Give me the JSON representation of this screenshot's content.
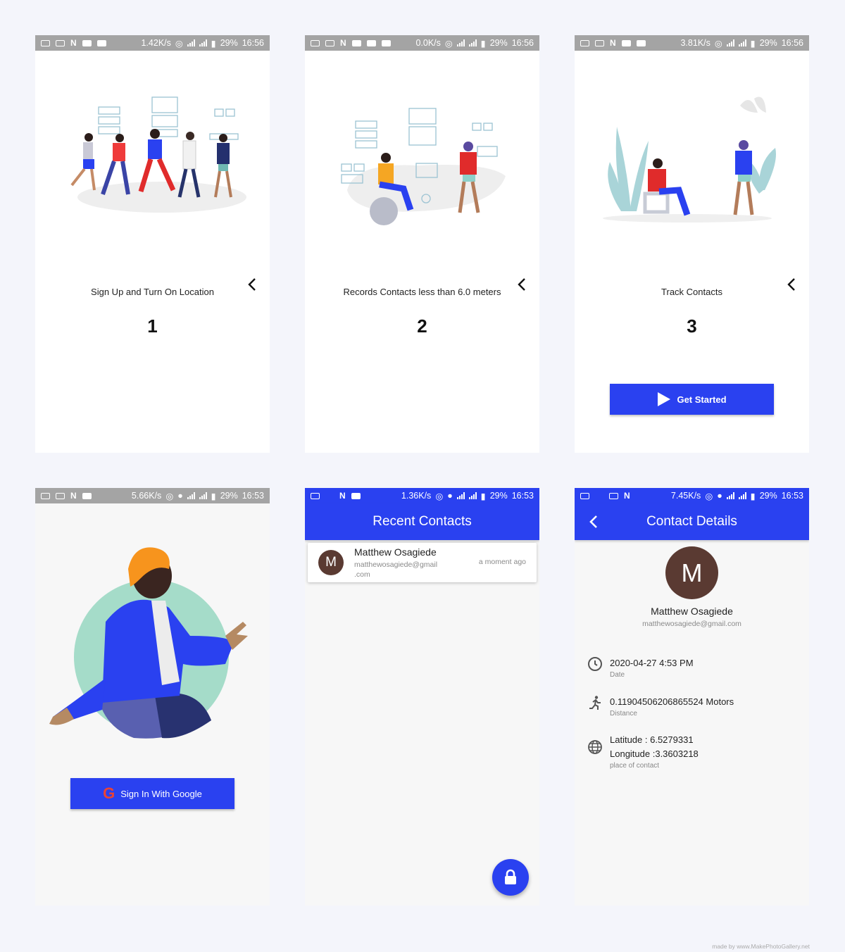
{
  "colors": {
    "accent": "#2a41f0",
    "status_grey": "#a4a4a4",
    "avatar": "#5a3a32"
  },
  "screens": {
    "onboard1": {
      "status": {
        "speed": "1.42K/s",
        "battery": "29%",
        "time": "16:56"
      },
      "caption": "Sign Up and Turn On Location",
      "step": "1"
    },
    "onboard2": {
      "status": {
        "speed": "0.0K/s",
        "battery": "29%",
        "time": "16:56"
      },
      "caption": "Records Contacts less than 6.0 meters",
      "step": "2"
    },
    "onboard3": {
      "status": {
        "speed": "3.81K/s",
        "battery": "29%",
        "time": "16:56"
      },
      "caption": "Track Contacts",
      "step": "3",
      "button": "Get Started"
    },
    "signin": {
      "status": {
        "speed": "5.66K/s",
        "battery": "29%",
        "time": "16:53"
      },
      "button": "Sign In With Google"
    },
    "recent": {
      "status": {
        "speed": "1.36K/s",
        "battery": "29%",
        "time": "16:53"
      },
      "title": "Recent Contacts",
      "items": [
        {
          "initial": "M",
          "name": "Matthew Osagiede",
          "email_line1": "matthewosagiede@gmail",
          "email_line2": ".com",
          "time": "a moment ago"
        }
      ],
      "fab_icon": "lock-icon"
    },
    "details": {
      "status": {
        "speed": "7.45K/s",
        "battery": "29%",
        "time": "16:53"
      },
      "title": "Contact Details",
      "initial": "M",
      "name": "Matthew Osagiede",
      "email": "matthewosagiede@gmail.com",
      "date": {
        "value": "2020-04-27  4:53 PM",
        "label": "Date"
      },
      "distance": {
        "value": "0.11904506206865524 Motors",
        "label": "Distance"
      },
      "location": {
        "latitude": "Latitude : 6.5279331",
        "longitude": "Longitude :3.3603218",
        "label": "place of contact"
      }
    }
  },
  "credit": "made by www.MakePhotoGallery.net"
}
